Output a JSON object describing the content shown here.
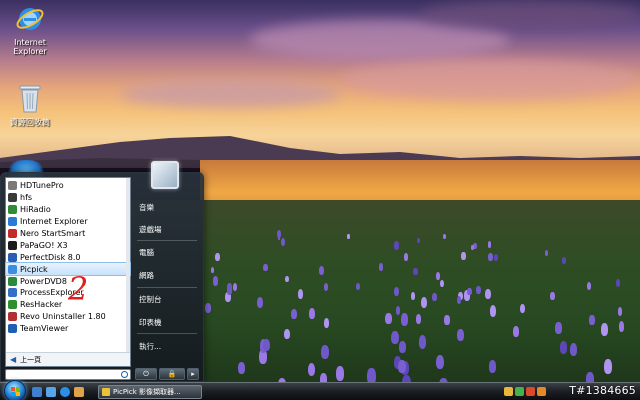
{
  "desktop": {
    "icons": [
      {
        "label": "Internet\nExplorer",
        "icon": "internet-explorer-icon"
      },
      {
        "label": "資源回收筒",
        "icon": "recycle-bin-icon"
      }
    ]
  },
  "start_menu": {
    "programs": [
      {
        "label": "HDTunePro",
        "icon": "hdtune-icon",
        "color": "#7a7a7a"
      },
      {
        "label": "hfs",
        "icon": "hfs-icon",
        "color": "#3a3a3a"
      },
      {
        "label": "HiRadio",
        "icon": "hiradio-icon",
        "color": "#2f8a3a"
      },
      {
        "label": "Internet Explorer",
        "icon": "internet-explorer-icon",
        "color": "#2a7bd6"
      },
      {
        "label": "Nero StartSmart",
        "icon": "nero-icon",
        "color": "#c42a2a"
      },
      {
        "label": "PaPaGO! X3",
        "icon": "papago-icon",
        "color": "#1c1c1c"
      },
      {
        "label": "PerfectDisk 8.0",
        "icon": "perfectdisk-icon",
        "color": "#2a5fb5"
      },
      {
        "label": "Picpick",
        "icon": "picpick-icon",
        "color": "#3c8ee0",
        "selected": true
      },
      {
        "label": "PowerDVD8",
        "icon": "powerdvd-icon",
        "color": "#2a8a3c"
      },
      {
        "label": "ProcessExplorer",
        "icon": "process-explorer-icon",
        "color": "#3470c8"
      },
      {
        "label": "ResHacker",
        "icon": "reshacker-icon",
        "color": "#2e8f2e"
      },
      {
        "label": "Revo Uninstaller 1.80",
        "icon": "revo-icon",
        "color": "#b23030"
      },
      {
        "label": "TeamViewer",
        "icon": "teamviewer-icon",
        "color": "#1d5fb0"
      }
    ],
    "back_label": "上一頁",
    "search_placeholder": "",
    "right_items": [
      "音樂",
      "遊戲場",
      "電腦",
      "網路",
      "控制台",
      "印表機",
      "執行..."
    ],
    "power_button_label": "⏻",
    "lock_button_label": "🔒",
    "arrow_button_label": "▸"
  },
  "annotation": "2",
  "taskbar": {
    "task_label": "PicPick 影像擷取器...",
    "watermark": "T#1384665"
  }
}
